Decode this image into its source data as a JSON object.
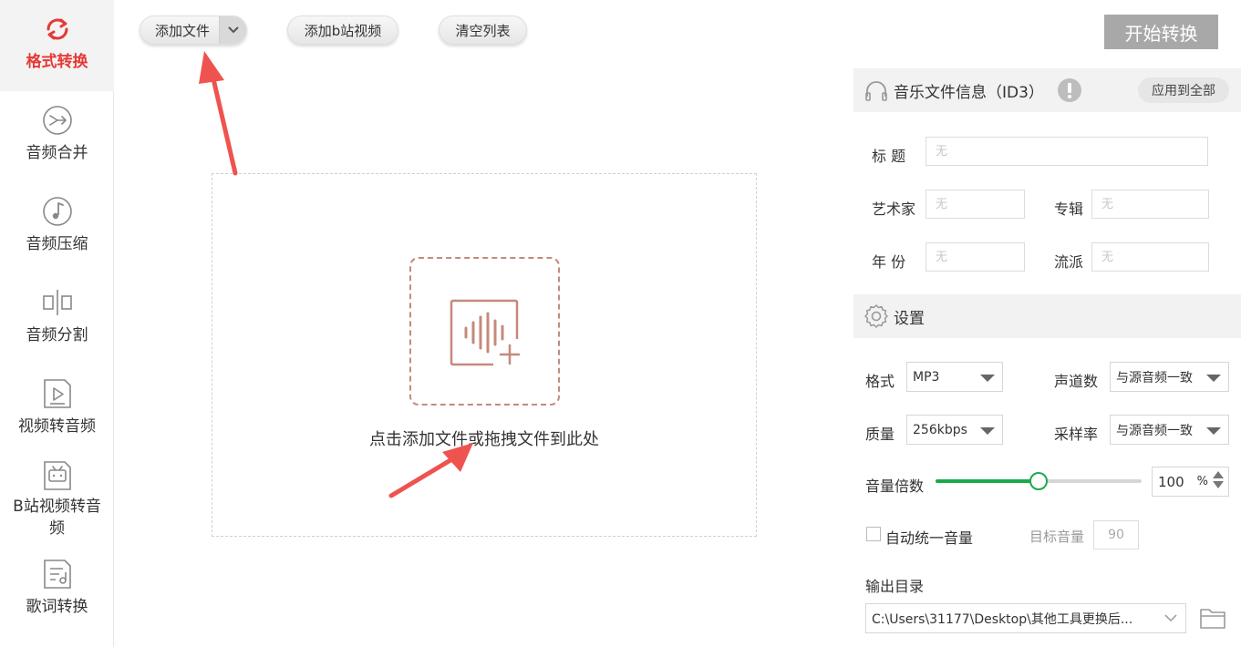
{
  "sidebar": {
    "items": [
      {
        "label": "格式转换",
        "icon": "refresh-icon"
      },
      {
        "label": "音频合并",
        "icon": "merge-icon"
      },
      {
        "label": "音频压缩",
        "icon": "music-note-icon"
      },
      {
        "label": "音频分割",
        "icon": "split-icon"
      },
      {
        "label": "视频转音频",
        "icon": "video-play-icon"
      },
      {
        "label": "B站视频转音频",
        "icon": "bilibili-tv-icon"
      },
      {
        "label": "歌词转换",
        "icon": "lyrics-doc-icon"
      }
    ]
  },
  "toolbar": {
    "add_file": "添加文件",
    "add_bilibili": "添加b站视频",
    "clear_list": "清空列表",
    "start": "开始转换"
  },
  "dropzone": {
    "text": "点击添加文件或拖拽文件到此处"
  },
  "id3": {
    "title": "音乐文件信息（ID3）",
    "apply_all": "应用到全部",
    "fields": {
      "title_label": "标 题",
      "artist_label": "艺术家",
      "album_label": "专辑",
      "year_label": "年 份",
      "genre_label": "流派",
      "placeholder": "无"
    }
  },
  "settings": {
    "title": "设置",
    "format_label": "格式",
    "format_value": "MP3",
    "channels_label": "声道数",
    "channels_value": "与源音频一致",
    "quality_label": "质量",
    "quality_value": "256kbps",
    "samplerate_label": "采样率",
    "samplerate_value": "与源音频一致",
    "volume_label": "音量倍数",
    "volume_value": "100",
    "volume_unit": "%",
    "volume_slider_percent": 50,
    "auto_volume_label": "自动统一音量",
    "auto_volume_checked": false,
    "target_volume_label": "目标音量",
    "target_volume_value": "90",
    "output_label": "输出目录",
    "output_path": "C:\\Users\\31177\\Desktop\\其他工具更换后..."
  },
  "colors": {
    "accent": "#e53935",
    "slider": "#1aab4a",
    "start_button": "#a8a8a8",
    "drop_icon": "#c48a7a",
    "arrow": "#ef5350"
  }
}
